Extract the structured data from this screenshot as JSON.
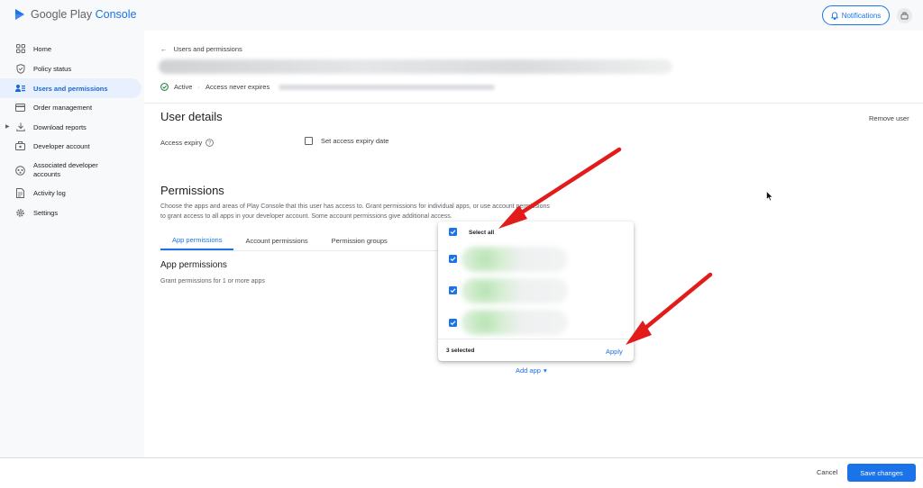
{
  "app": {
    "brand_prefix": "Google Play",
    "brand_suffix": "Console",
    "notifications_label": "Notifications"
  },
  "sidebar": {
    "items": [
      {
        "label": "Home",
        "icon": "home-grid-icon"
      },
      {
        "label": "Policy status",
        "icon": "shield-icon"
      },
      {
        "label": "Users and permissions",
        "icon": "users-icon",
        "active": true
      },
      {
        "label": "Order management",
        "icon": "card-icon"
      },
      {
        "label": "Download reports",
        "icon": "download-icon"
      },
      {
        "label": "Developer account",
        "icon": "briefcase-icon"
      },
      {
        "label": "Associated developer accounts",
        "icon": "link-circle-icon"
      },
      {
        "label": "Activity log",
        "icon": "document-icon"
      },
      {
        "label": "Settings",
        "icon": "gear-icon"
      }
    ]
  },
  "header": {
    "back_label": "Users and permissions",
    "status": "Active",
    "expiry": "Access never expires"
  },
  "user_details": {
    "title": "User details",
    "remove_user": "Remove user",
    "access_expiry_label": "Access expiry",
    "set_expiry_label": "Set access expiry date"
  },
  "permissions": {
    "title": "Permissions",
    "description_line1": "Choose the apps and areas of Play Console that this user has access to. Grant permissions for individual apps, or use account permissions",
    "description_line2": "to grant access to all apps in your developer account. Some account permissions give additional access.",
    "tabs": [
      "App permissions",
      "Account permissions",
      "Permission groups"
    ],
    "active_tab": 0,
    "app_permissions_title": "App permissions",
    "app_permissions_desc": "Grant permissions for 1 or more apps",
    "add_app": "Add app"
  },
  "app_picker": {
    "select_all": "Select all",
    "select_all_checked": true,
    "apps_checked": [
      true,
      true,
      true
    ],
    "selected_count": "3 selected",
    "apply": "Apply"
  },
  "footer": {
    "cancel": "Cancel",
    "save": "Save changes"
  },
  "colors": {
    "accent": "#1a73e8",
    "arrow": "#e21b1b",
    "status_green": "#188038"
  }
}
